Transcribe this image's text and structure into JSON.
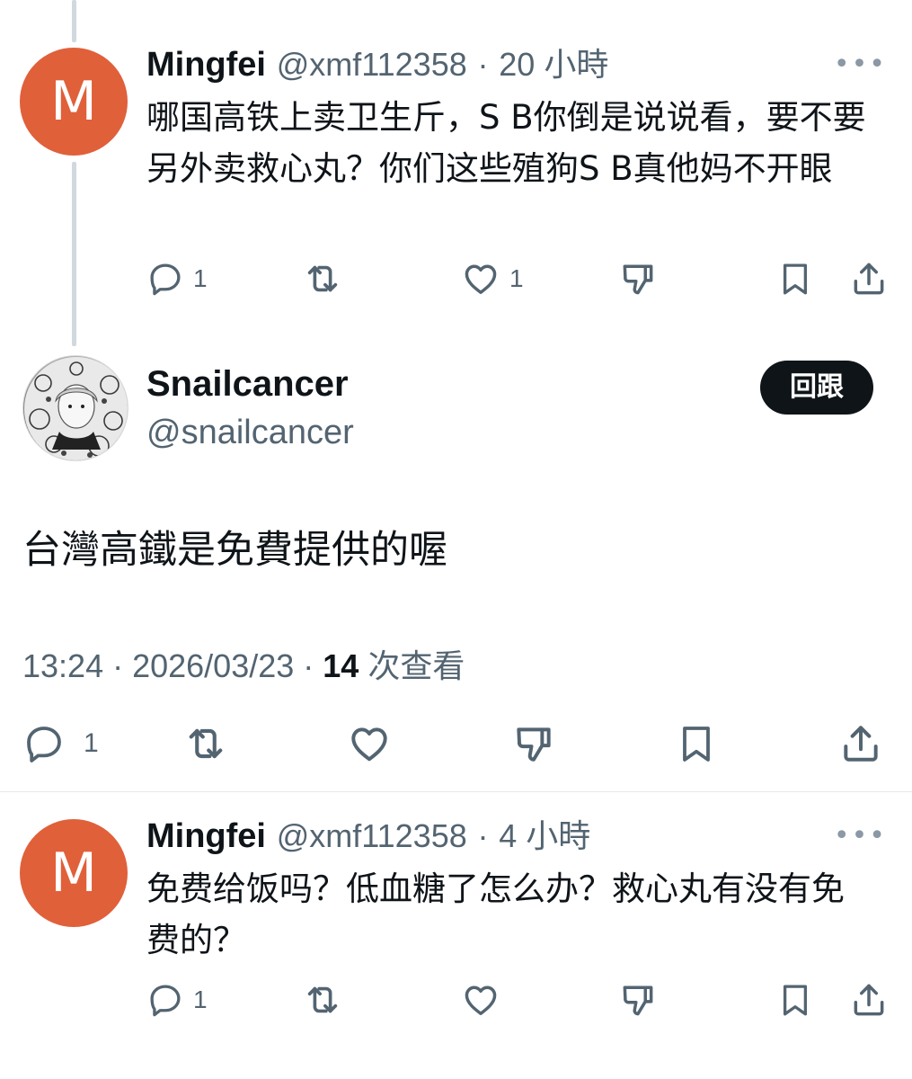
{
  "reply_one": {
    "avatar_letter": "M",
    "name": "Mingfei",
    "handle": "@xmf112358",
    "separator": "·",
    "time": "20 小時",
    "more": "•••",
    "text": "哪国高铁上卖卫生斤，S B你倒是说说看，要不要另外卖救心丸？你们这些殖狗S B真他妈不开眼",
    "reply_count": "1",
    "like_count": "1"
  },
  "main_tweet": {
    "name": "Snailcancer",
    "handle": "@snailcancer",
    "reply_button": "回跟",
    "text": "台灣高鐵是免費提供的喔",
    "timestamp": "13:24 · 2026/03/23 ·",
    "views_count": "14",
    "views_label": "次查看",
    "reply_count": "1"
  },
  "reply_two": {
    "avatar_letter": "M",
    "name": "Mingfei",
    "handle": "@xmf112358",
    "separator": "·",
    "time": "4 小時",
    "more": "•••",
    "text": "免费给饭吗？低血糖了怎么办？救心丸有没有免费的？",
    "reply_count": "1"
  },
  "colors": {
    "avatar_bg": "#e0603a",
    "text_primary": "#0f1419",
    "text_secondary": "#536471",
    "thread_line": "#cfd9de",
    "button_bg": "#0f1419"
  },
  "icons": [
    "reply-icon",
    "retweet-icon",
    "like-icon",
    "dislike-icon",
    "bookmark-icon",
    "share-icon",
    "more-icon"
  ]
}
